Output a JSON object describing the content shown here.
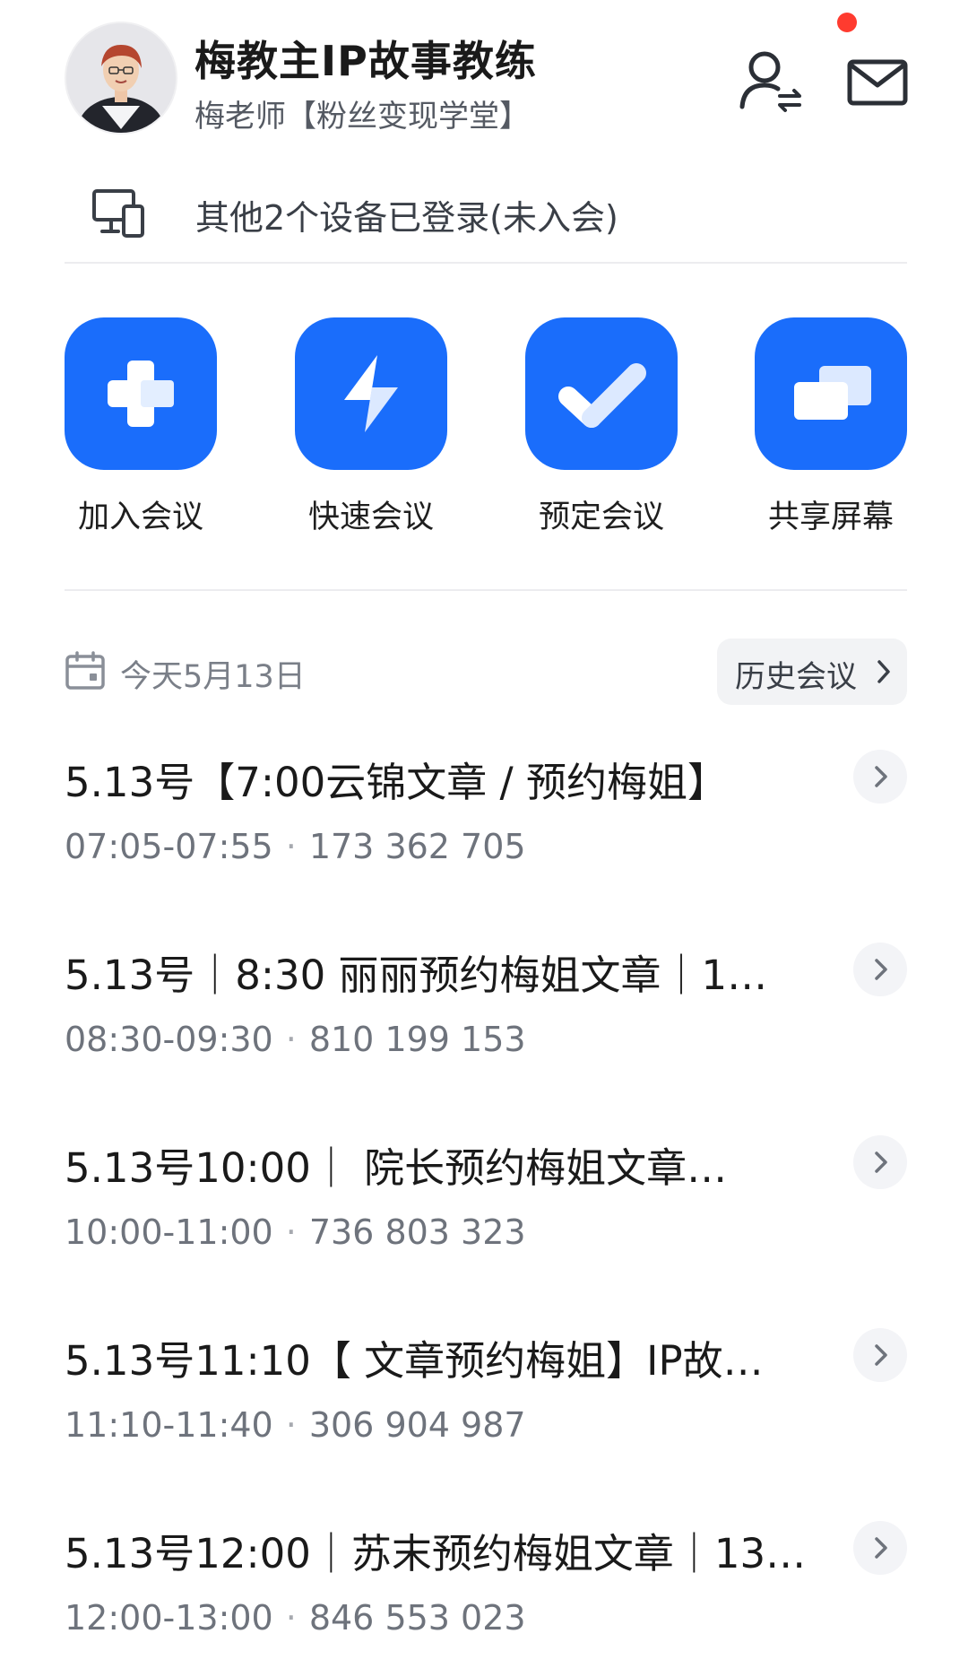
{
  "header": {
    "account_name": "梅教主IP故事教练",
    "account_sub": "梅老师【粉丝变现学堂】",
    "notification_dot_color": "#ff3b2f"
  },
  "devices": {
    "text": "其他2个设备已登录(未入会)"
  },
  "actions": [
    {
      "label": "加入会议",
      "icon": "plus-icon"
    },
    {
      "label": "快速会议",
      "icon": "lightning-icon"
    },
    {
      "label": "预定会议",
      "icon": "check-icon"
    },
    {
      "label": "共享屏幕",
      "icon": "share-screen-icon"
    }
  ],
  "accent_color": "#1a6dfb",
  "today": {
    "date_label": "今天5月13日",
    "history_label": "历史会议"
  },
  "meetings": [
    {
      "title": "5.13号【7:00云锦文章 / 预约梅姐】",
      "time": "07:05-07:55",
      "id": "173 362 705"
    },
    {
      "title": "5.13号｜8:30 丽丽预约梅姐文章｜1…",
      "time": "08:30-09:30",
      "id": "810 199 153"
    },
    {
      "title": "5.13号10:00｜ 院长预约梅姐文章…",
      "time": "10:00-11:00",
      "id": "736 803 323"
    },
    {
      "title": "5.13号11:10【 文章预约梅姐】IP故…",
      "time": "11:10-11:40",
      "id": "306 904 987"
    },
    {
      "title": "5.13号12:00｜苏末预约梅姐文章｜13…",
      "time": "12:00-13:00",
      "id": "846 553 023"
    }
  ]
}
